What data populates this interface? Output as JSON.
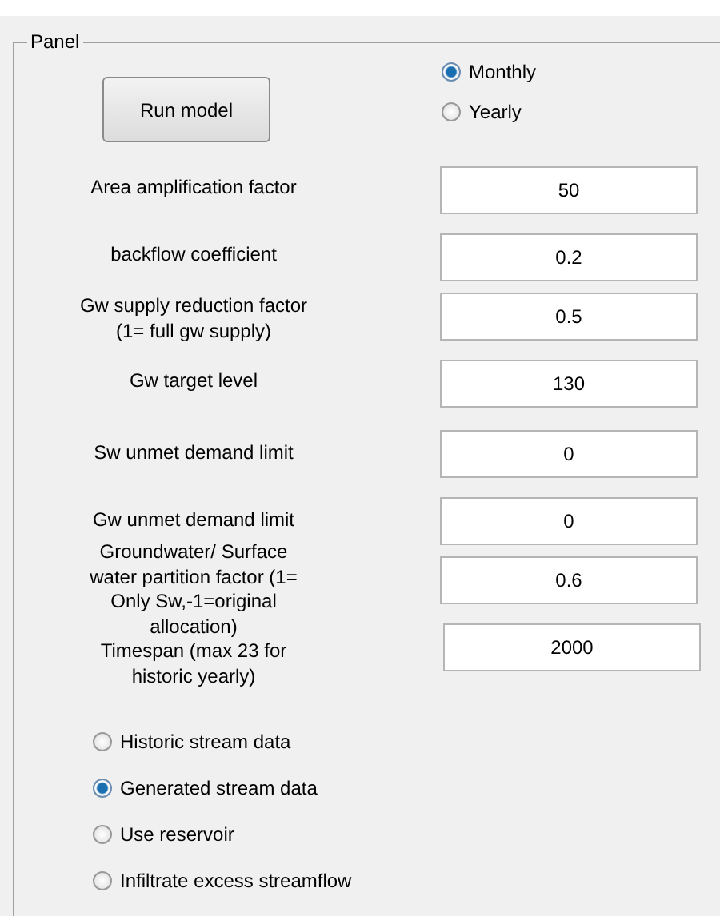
{
  "panel": {
    "title": "Panel"
  },
  "run_button": {
    "label": "Run model"
  },
  "period": [
    {
      "label": "Monthly",
      "selected": true
    },
    {
      "label": "Yearly",
      "selected": false
    }
  ],
  "parameters": [
    {
      "label": "Area amplification factor",
      "value": "50"
    },
    {
      "label": "backflow coefficient",
      "value": "0.2"
    },
    {
      "label": "Gw supply reduction factor\n(1= full gw supply)",
      "value": "0.5"
    },
    {
      "label": "Gw target level",
      "value": "130"
    },
    {
      "label": "Sw unmet demand limit",
      "value": "0"
    },
    {
      "label": "Gw unmet demand limit",
      "value": "0"
    },
    {
      "label": "Groundwater/ Surface\nwater partition factor (1=\nOnly Sw,-1=original\nallocation)",
      "value": "0.6"
    },
    {
      "label": "Timespan (max 23 for\nhistoric yearly)",
      "value": "2000"
    }
  ],
  "options": [
    {
      "label": "Historic stream data",
      "selected": false
    },
    {
      "label": "Generated stream data",
      "selected": true
    },
    {
      "label": "Use reservoir",
      "selected": false
    },
    {
      "label": "Infiltrate excess streamflow",
      "selected": false
    }
  ]
}
